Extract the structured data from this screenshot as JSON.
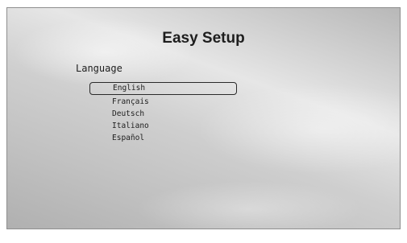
{
  "screen": {
    "title": "Easy Setup",
    "section_label": "Language",
    "languages": [
      {
        "label": "English",
        "selected": true
      },
      {
        "label": "Français",
        "selected": false
      },
      {
        "label": "Deutsch",
        "selected": false
      },
      {
        "label": "Italiano",
        "selected": false
      },
      {
        "label": "Español",
        "selected": false
      }
    ]
  }
}
